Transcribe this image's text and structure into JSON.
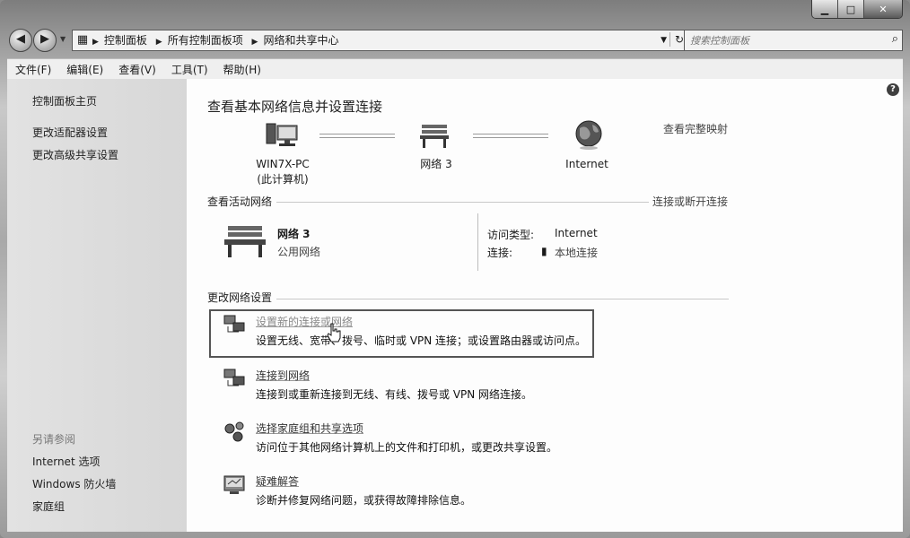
{
  "window": {
    "minimize_icon": "minimize-icon",
    "maximize_icon": "maximize-icon",
    "close_icon": "close-icon"
  },
  "nav": {
    "back_icon": "back-arrow-icon",
    "forward_icon": "forward-arrow-icon"
  },
  "address": {
    "crumbs": [
      "控制面板",
      "所有控制面板项",
      "网络和共享中心"
    ]
  },
  "search": {
    "placeholder": "搜索控制面板"
  },
  "menu": [
    "文件(F)",
    "编辑(E)",
    "查看(V)",
    "工具(T)",
    "帮助(H)"
  ],
  "sidebar": {
    "links": [
      "控制面板主页",
      "更改适配器设置",
      "更改高级共享设置"
    ],
    "see_also_title": "另请参阅",
    "see_also": [
      "Internet 选项",
      "Windows 防火墙",
      "家庭组"
    ]
  },
  "main": {
    "title": "查看基本网络信息并设置连接",
    "full_map_link": "查看完整映射",
    "map": {
      "computer_label": "WIN7X-PC",
      "computer_sub": "(此计算机)",
      "network_label": "网络  3",
      "internet_label": "Internet"
    },
    "active_section": {
      "title": "查看活动网络",
      "link": "连接或断开连接",
      "network_name": "网络  3",
      "network_type": "公用网络",
      "access_type_label": "访问类型:",
      "access_type_value": "Internet",
      "connection_label": "连接:",
      "connection_value": "本地连接"
    },
    "change_section": {
      "title": "更改网络设置",
      "tasks": [
        {
          "link": "设置新的连接或网络",
          "desc": "设置无线、宽带、拨号、临时或 VPN 连接；或设置路由器或访问点。"
        },
        {
          "link": "连接到网络",
          "desc": "连接到或重新连接到无线、有线、拨号或 VPN 网络连接。"
        },
        {
          "link": "选择家庭组和共享选项",
          "desc": "访问位于其他网络计算机上的文件和打印机，或更改共享设置。"
        },
        {
          "link": "疑难解答",
          "desc": "诊断并修复网络问题，或获得故障排除信息。"
        }
      ]
    }
  }
}
